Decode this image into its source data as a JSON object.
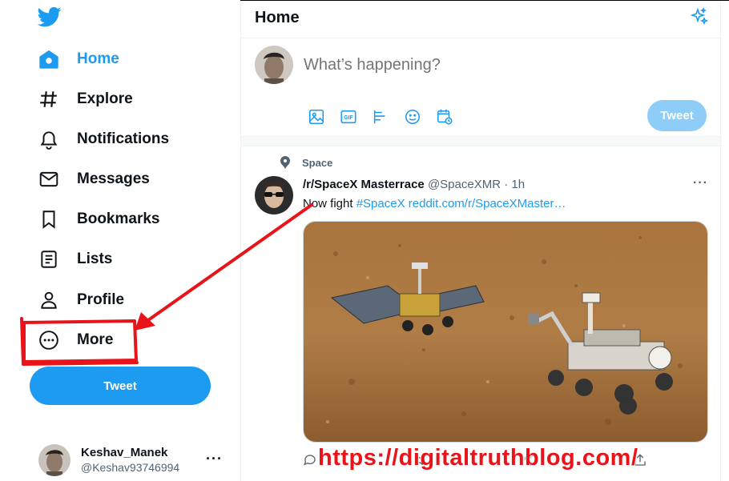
{
  "sidebar": {
    "nav": [
      {
        "label": "Home",
        "icon": "home-icon",
        "active": true
      },
      {
        "label": "Explore",
        "icon": "hashtag-icon"
      },
      {
        "label": "Notifications",
        "icon": "bell-icon"
      },
      {
        "label": "Messages",
        "icon": "envelope-icon"
      },
      {
        "label": "Bookmarks",
        "icon": "bookmark-icon"
      },
      {
        "label": "Lists",
        "icon": "list-icon"
      },
      {
        "label": "Profile",
        "icon": "person-icon"
      },
      {
        "label": "More",
        "icon": "more-circle-icon"
      }
    ],
    "tweet_button": "Tweet",
    "account": {
      "display_name": "Keshav_Manek",
      "handle": "@Keshav93746994",
      "menu": "···"
    }
  },
  "header": {
    "title": "Home",
    "icon": "sparkle-icon"
  },
  "composer": {
    "placeholder": "What’s happening?",
    "tools": [
      "image-icon",
      "gif-icon",
      "poll-icon",
      "emoji-icon",
      "schedule-icon"
    ],
    "tweet_button": "Tweet"
  },
  "tweet": {
    "context": "Space",
    "name": "/r/SpaceX Masterrace",
    "meta": "@SpaceXMR · 1h",
    "more": "···",
    "text": "Now fight ",
    "hashtag": "#SpaceX",
    "link": "reddit.com/r/SpaceXMaster…",
    "media": "Mars rovers on rocky terrain",
    "actions": [
      "reply-icon",
      "retweet-icon",
      "like-icon",
      "share-icon"
    ]
  },
  "overlay": {
    "watermark": "https://digitaltruthblog.com/",
    "annotation_color": "#e8141a"
  },
  "colors": {
    "accent": "#1d9bf0",
    "accent_disabled": "#8ecdf8",
    "text": "#0f1419",
    "secondary": "#536471"
  }
}
